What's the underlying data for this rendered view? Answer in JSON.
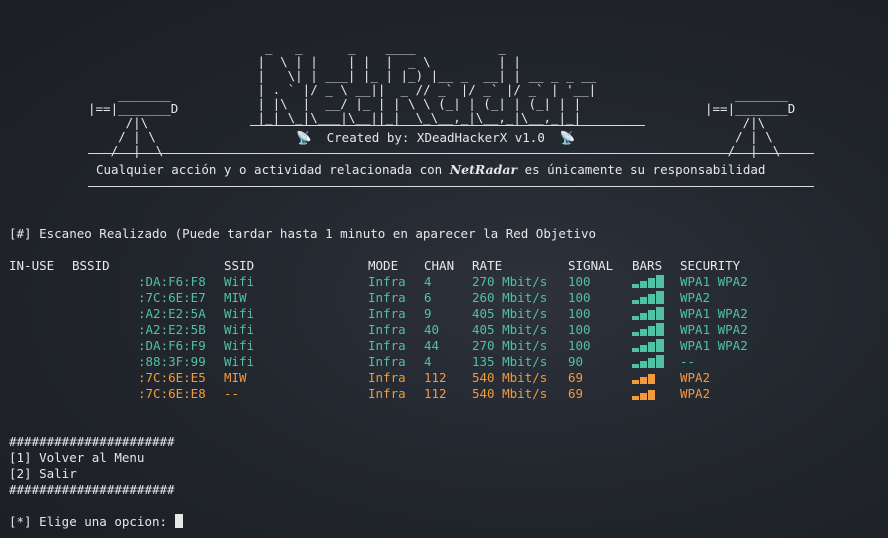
{
  "banner": {
    "logo_ascii": "  _   _      _    ____           _\n |  \\ | |    | |  |  _ \\         | |\n |   \\| | ___| |_ | |_) |__ _  __| | __ _ _ __\n | . ` |/ _ \\ __||  _ // _` |/ _` |/ _` | '__|\n | |\\  |  __/ |_ | | \\ \\ (_| | (_| | (_| | |\n |_| \\_|\\___|\\__||_|  \\_\\__,_|\\__,_|\\__,_|_|",
    "satellite_left": "    _______\n|==|_______D\n     /|\\\n    / | \\\n   /  |  \\",
    "satellite_right": "    _______\n|==|_______D\n     /|\\\n    / | \\\n   /  |  \\",
    "credit": "📡  Created by: XDeadHackerX v1.0  📡",
    "warning_prefix": "Cualquier acción y o actividad relacionada con ",
    "warning_brand": "NetRadar",
    "warning_suffix": " es únicamente su responsabilidad"
  },
  "status_line": "[#] Escaneo Realizado (Puede tardar hasta 1 minuto en aparecer la Red Objetivo",
  "table": {
    "headers": [
      "IN-USE",
      "BSSID",
      "SSID",
      "MODE",
      "CHAN",
      "RATE",
      "SIGNAL",
      "BARS",
      "SECURITY"
    ],
    "rows": [
      {
        "bssid": ":DA:F6:F8",
        "ssid": "Wifi",
        "mode": "Infra",
        "chan": "4",
        "rate": "270 Mbit/s",
        "signal": "100",
        "bars": 4,
        "security": "WPA1 WPA2",
        "color": "#4fc1a6"
      },
      {
        "bssid": ":7C:6E:E7",
        "ssid": "MIW",
        "mode": "Infra",
        "chan": "6",
        "rate": "260 Mbit/s",
        "signal": "100",
        "bars": 4,
        "security": "WPA2",
        "color": "#4fc1a6"
      },
      {
        "bssid": ":A2:E2:5A",
        "ssid": "Wifi",
        "mode": "Infra",
        "chan": "9",
        "rate": "405 Mbit/s",
        "signal": "100",
        "bars": 4,
        "security": "WPA1 WPA2",
        "color": "#4fc1a6"
      },
      {
        "bssid": ":A2:E2:5B",
        "ssid": "Wifi",
        "mode": "Infra",
        "chan": "40",
        "rate": "405 Mbit/s",
        "signal": "100",
        "bars": 4,
        "security": "WPA1 WPA2",
        "color": "#4fc1a6"
      },
      {
        "bssid": ":DA:F6:F9",
        "ssid": "Wifi",
        "mode": "Infra",
        "chan": "44",
        "rate": "270 Mbit/s",
        "signal": "100",
        "bars": 4,
        "security": "WPA1 WPA2",
        "color": "#4fc1a6"
      },
      {
        "bssid": ":88:3F:99",
        "ssid": "Wifi",
        "mode": "Infra",
        "chan": "4",
        "rate": "135 Mbit/s",
        "signal": "90",
        "bars": 4,
        "security": "--",
        "color": "#4fc1a6"
      },
      {
        "bssid": ":7C:6E:E5",
        "ssid": "MIW",
        "mode": "Infra",
        "chan": "112",
        "rate": "540 Mbit/s",
        "signal": "69",
        "bars": 3,
        "security": "WPA2",
        "color": "#f19a3e"
      },
      {
        "bssid": ":7C:6E:E8",
        "ssid": "--",
        "mode": "Infra",
        "chan": "112",
        "rate": "540 Mbit/s",
        "signal": "69",
        "bars": 3,
        "security": "WPA2",
        "color": "#f19a3e"
      }
    ]
  },
  "menu": {
    "separator": "######################",
    "option1": "[1] Volver al Menu",
    "option2": "[2] Salir",
    "prompt": "[*] Elige una opcion: "
  },
  "colors": {
    "strong": "#4fc1a6",
    "medium": "#f19a3e",
    "text": "#e8e8e8"
  }
}
